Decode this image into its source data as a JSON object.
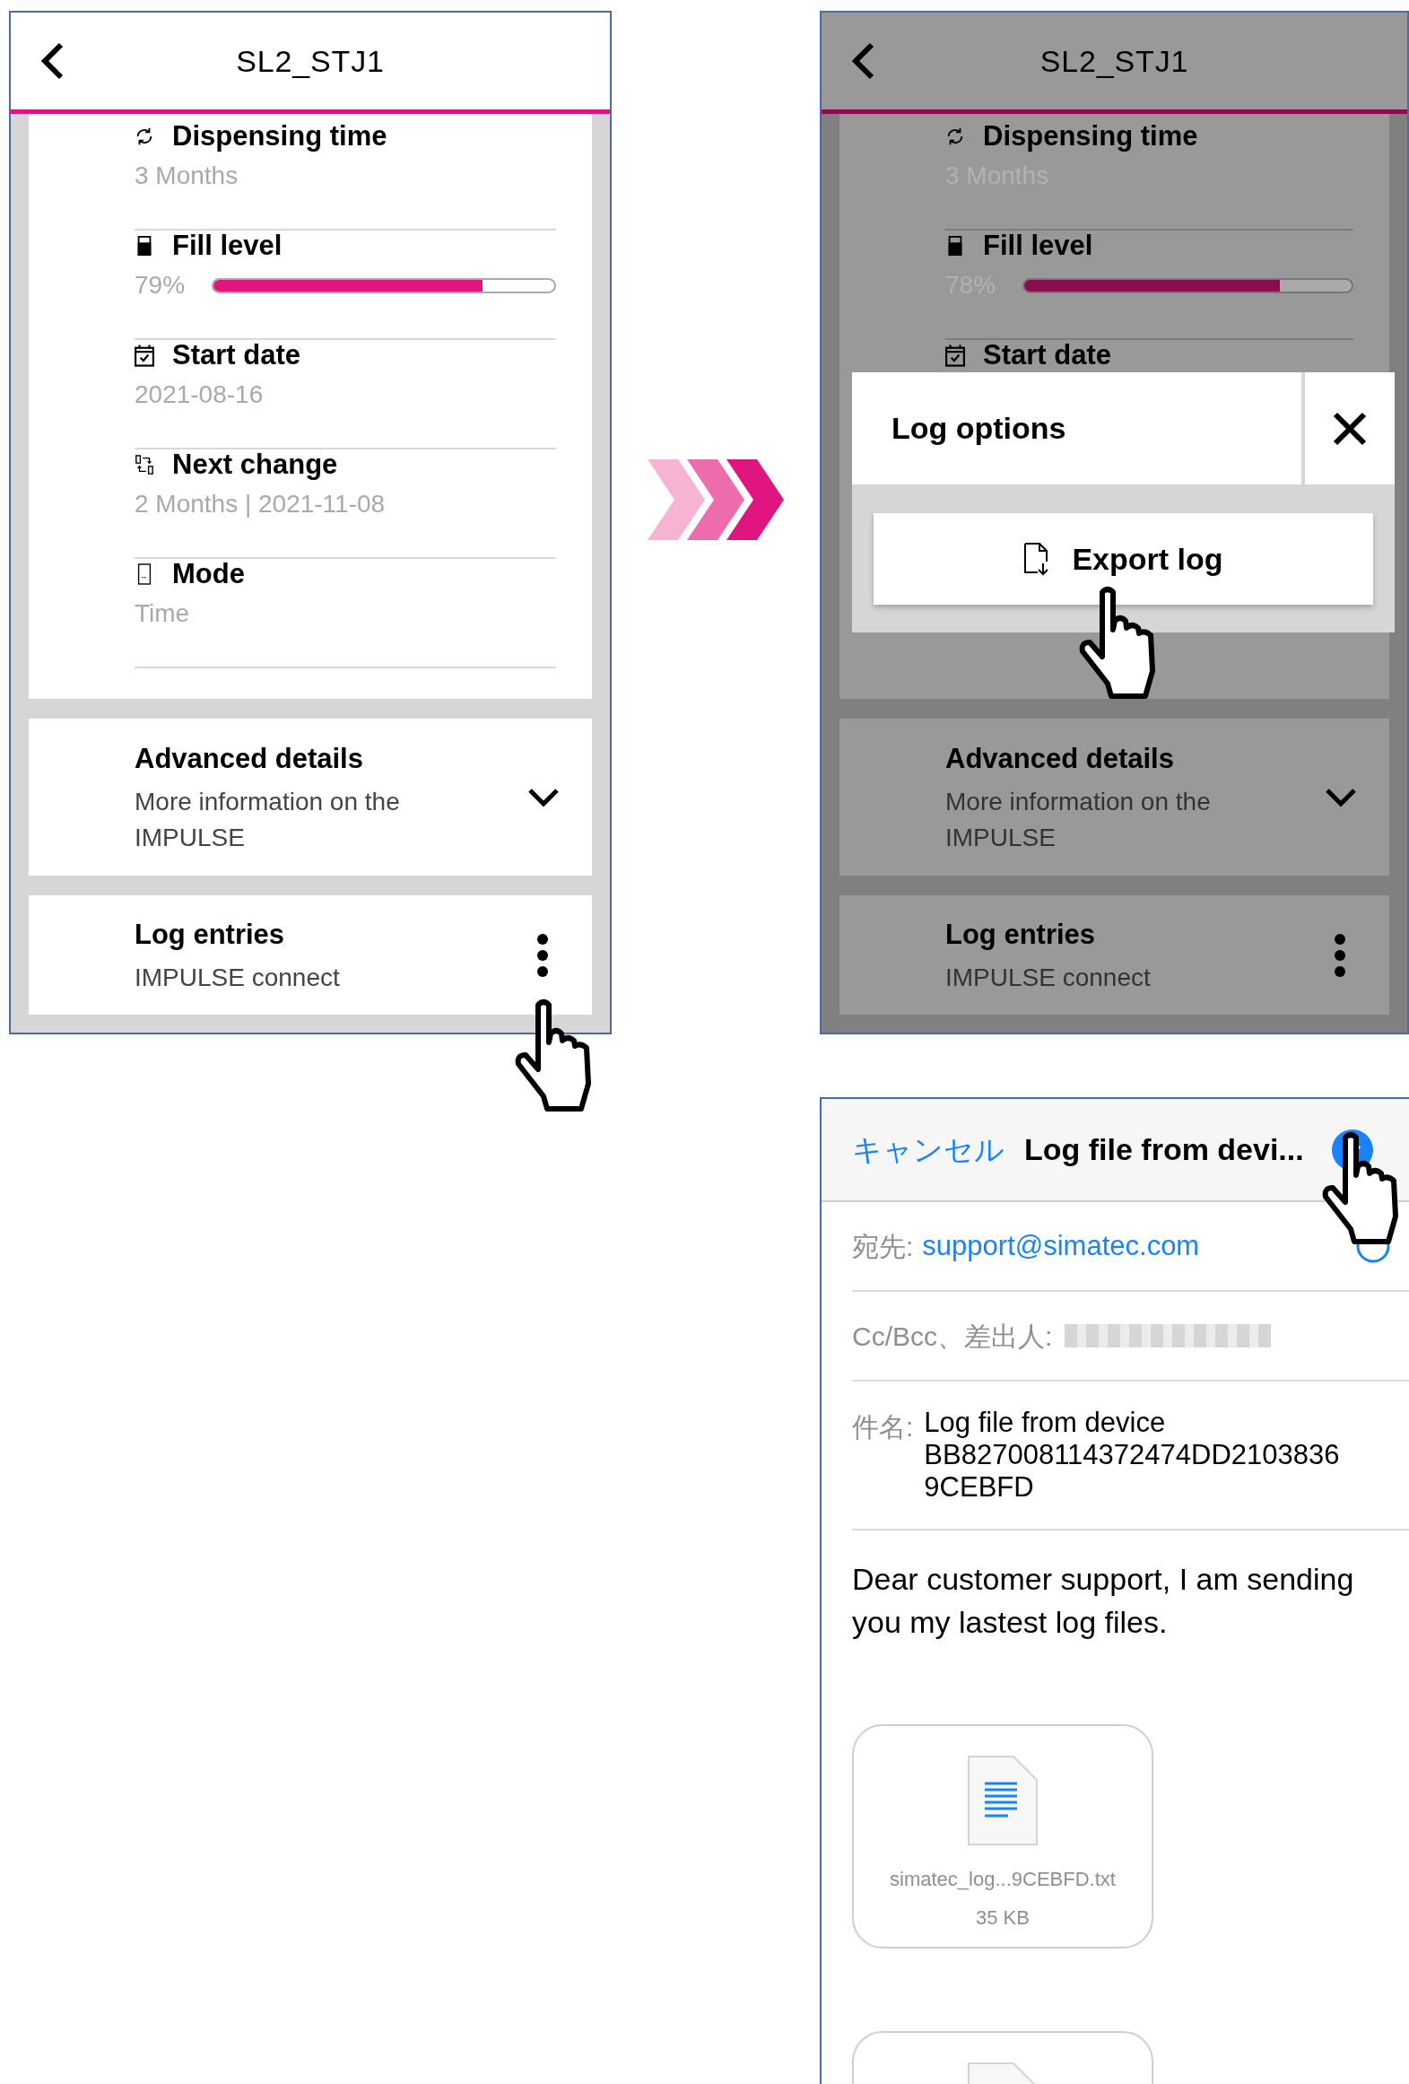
{
  "device_screen": {
    "title": "SL2_STJ1",
    "rows": [
      {
        "kind": "text",
        "label": "Dispensing time",
        "value": "3 Months"
      },
      {
        "kind": "level",
        "label": "Fill level",
        "reading": "79%",
        "level": 0.79
      },
      {
        "kind": "text",
        "label": "Start date",
        "value": "2021-08-16"
      },
      {
        "kind": "text",
        "label": "Next change",
        "value": "2 Months | 2021-11-08"
      },
      {
        "kind": "text",
        "label": "Mode",
        "value": "Time"
      }
    ],
    "sections": [
      {
        "kind": "expand",
        "title": "Advanced details",
        "subtitle": "More information on the IMPULSE",
        "expanded": false
      },
      {
        "kind": "menu",
        "title": "Log entries",
        "subtitle": "IMPULSE connect"
      }
    ]
  },
  "dimmed_screen": {
    "title": "SL2_STJ1",
    "rows": [
      {
        "kind": "text",
        "label": "Dispensing time",
        "value": "3 Months"
      },
      {
        "kind": "level",
        "label": "Fill level",
        "reading": "78%",
        "level": 0.78
      },
      {
        "kind": "label",
        "label": "Start date"
      }
    ],
    "sections": [
      {
        "kind": "expand",
        "title": "Advanced details",
        "subtitle": "More information on the IMPULSE",
        "expanded": false
      },
      {
        "kind": "menu",
        "title": "Log entries",
        "subtitle": "IMPULSE connect"
      }
    ],
    "dialog": {
      "title": "Log options",
      "button": "Export log"
    }
  },
  "mail": {
    "cancel": "キャンセル",
    "title": "Log file from devi...",
    "to_label": "宛先:",
    "to": "support@simatec.com",
    "cc_label": "Cc/Bcc、差出人:",
    "subject_label": "件名:",
    "subject": "Log file from device BB827008114372474DD21038369CEBFD",
    "body": "Dear customer support, I am sending you my lastest log files.",
    "attachments": [
      {
        "kind": "file",
        "name": "simatec_log...9CEBFD.txt",
        "size": "35 KB"
      },
      {
        "kind": "partial"
      }
    ]
  }
}
